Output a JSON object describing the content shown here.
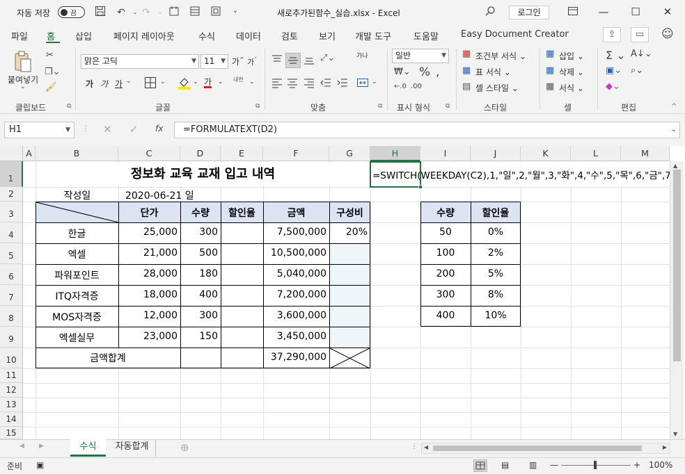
{
  "title_bar": {
    "autosave_label": "자동 저장",
    "autosave_state": "끔",
    "file_title": "새로추가된함수_실습.xlsx  -  Excel",
    "login_label": "로그인",
    "icons": [
      "save-icon",
      "undo-icon",
      "redo-icon",
      "touch-mode-icon",
      "form-icon",
      "customize-qat-icon",
      "search-icon",
      "ribbon-display-icon",
      "minimize-icon",
      "maximize-icon",
      "close-icon"
    ]
  },
  "menu": {
    "tabs": [
      "파일",
      "홈",
      "삽입",
      "페이지 레이아웃",
      "수식",
      "데이터",
      "검토",
      "보기",
      "개발 도구",
      "도움말",
      "Easy Document Creator"
    ],
    "active_tab": "홈"
  },
  "ribbon": {
    "clipboard": {
      "paste_label": "붙여넣기",
      "group_label": "클립보드"
    },
    "font": {
      "font_name": "맑은 고딕",
      "font_size": "11",
      "grow_glyph": "가",
      "shrink_glyph": "가",
      "bold_glyph": "가",
      "italic_glyph": "가",
      "underline_glyph": "가",
      "font_color_glyph": "가",
      "phonetic_glyph": "내천",
      "group_label": "글꼴"
    },
    "alignment": {
      "group_label": "맞춤",
      "orientation_glyph": "가나"
    },
    "number": {
      "format": "일반",
      "group_label": "표시 형식"
    },
    "styles": {
      "conditional_label": "조건부 서식",
      "table_label": "표 서식",
      "cell_style_label": "셀 스타일",
      "group_label": "스타일"
    },
    "cells": {
      "insert_label": "삽입",
      "delete_label": "삭제",
      "format_label": "서식",
      "group_label": "셀"
    },
    "editing": {
      "group_label": "편집"
    }
  },
  "formula_bar": {
    "name_box": "H1",
    "formula": "=FORMULATEXT(D2)",
    "fx_label": "fx"
  },
  "grid": {
    "columns": [
      "A",
      "B",
      "C",
      "D",
      "E",
      "F",
      "G",
      "H",
      "I",
      "J",
      "K",
      "L",
      "M"
    ],
    "selected_column": "H",
    "rows": [
      "1",
      "2",
      "3",
      "4",
      "5",
      "6",
      "7",
      "8",
      "9",
      "10",
      "11",
      "12",
      "13",
      "14",
      "15"
    ],
    "selected_row": "1",
    "title": "정보화 교육 교재 입고 내역",
    "overflow_formula": "=SWITCH(WEEKDAY(C2),1,\"일\",2,\"월\",3,\"화\",4,\"수\",5,\"목\",6,\"금\",7,",
    "author_label": "작성일",
    "author_date": "2020-06-21 일",
    "headers": [
      "단가",
      "수량",
      "할인율",
      "금액",
      "구성비"
    ],
    "items": [
      {
        "name": "한글",
        "price": "25,000",
        "qty": "300",
        "rate": "",
        "amount": "7,500,000",
        "ratio": "20%"
      },
      {
        "name": "엑셀",
        "price": "21,000",
        "qty": "500",
        "rate": "",
        "amount": "10,500,000",
        "ratio": ""
      },
      {
        "name": "파워포인트",
        "price": "28,000",
        "qty": "180",
        "rate": "",
        "amount": "5,040,000",
        "ratio": ""
      },
      {
        "name": "ITQ자격증",
        "price": "18,000",
        "qty": "400",
        "rate": "",
        "amount": "7,200,000",
        "ratio": ""
      },
      {
        "name": "MOS자격증",
        "price": "12,000",
        "qty": "300",
        "rate": "",
        "amount": "3,600,000",
        "ratio": ""
      },
      {
        "name": "엑셀실무",
        "price": "23,000",
        "qty": "150",
        "rate": "",
        "amount": "3,450,000",
        "ratio": ""
      }
    ],
    "total_label": "금액합계",
    "total_amount": "37,290,000",
    "lookup_headers": [
      "수량",
      "할인율"
    ],
    "lookup": [
      {
        "qty": "50",
        "rate": "0%"
      },
      {
        "qty": "100",
        "rate": "2%"
      },
      {
        "qty": "200",
        "rate": "5%"
      },
      {
        "qty": "300",
        "rate": "8%"
      },
      {
        "qty": "400",
        "rate": "10%"
      }
    ]
  },
  "sheet_tabs": {
    "tabs": [
      "수식",
      "자동합계"
    ],
    "active": "수식"
  },
  "status_bar": {
    "ready": "준비",
    "zoom": "100%"
  },
  "colors": {
    "accent": "#217346",
    "header_fill": "#dce3f3",
    "ratio_fill": "#eef6f8"
  }
}
